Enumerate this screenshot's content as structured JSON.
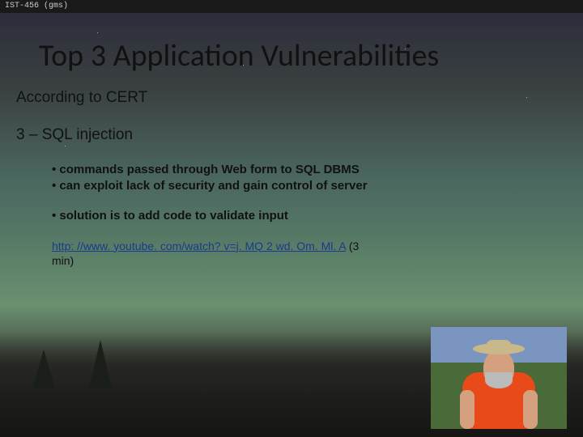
{
  "header": {
    "label": "IST-456 (gms)"
  },
  "slide": {
    "title": "Top 3 Application Vulnerabilities",
    "subtitle": "According to CERT",
    "section": "3 – SQL injection",
    "bullets": {
      "group1_line1": "• commands passed through Web form to SQL DBMS",
      "group1_line2": "• can exploit lack of security and gain control of server",
      "group2_line1": "• solution is to add code to validate input"
    },
    "link": {
      "url_text": "http: //www. youtube. com/watch? v=j. MQ 2 wd. Om. Ml. A",
      "href": "http://www.youtube.com/watch?v=jMQ2wdOmMlA",
      "suffix": " (3 min)"
    }
  }
}
